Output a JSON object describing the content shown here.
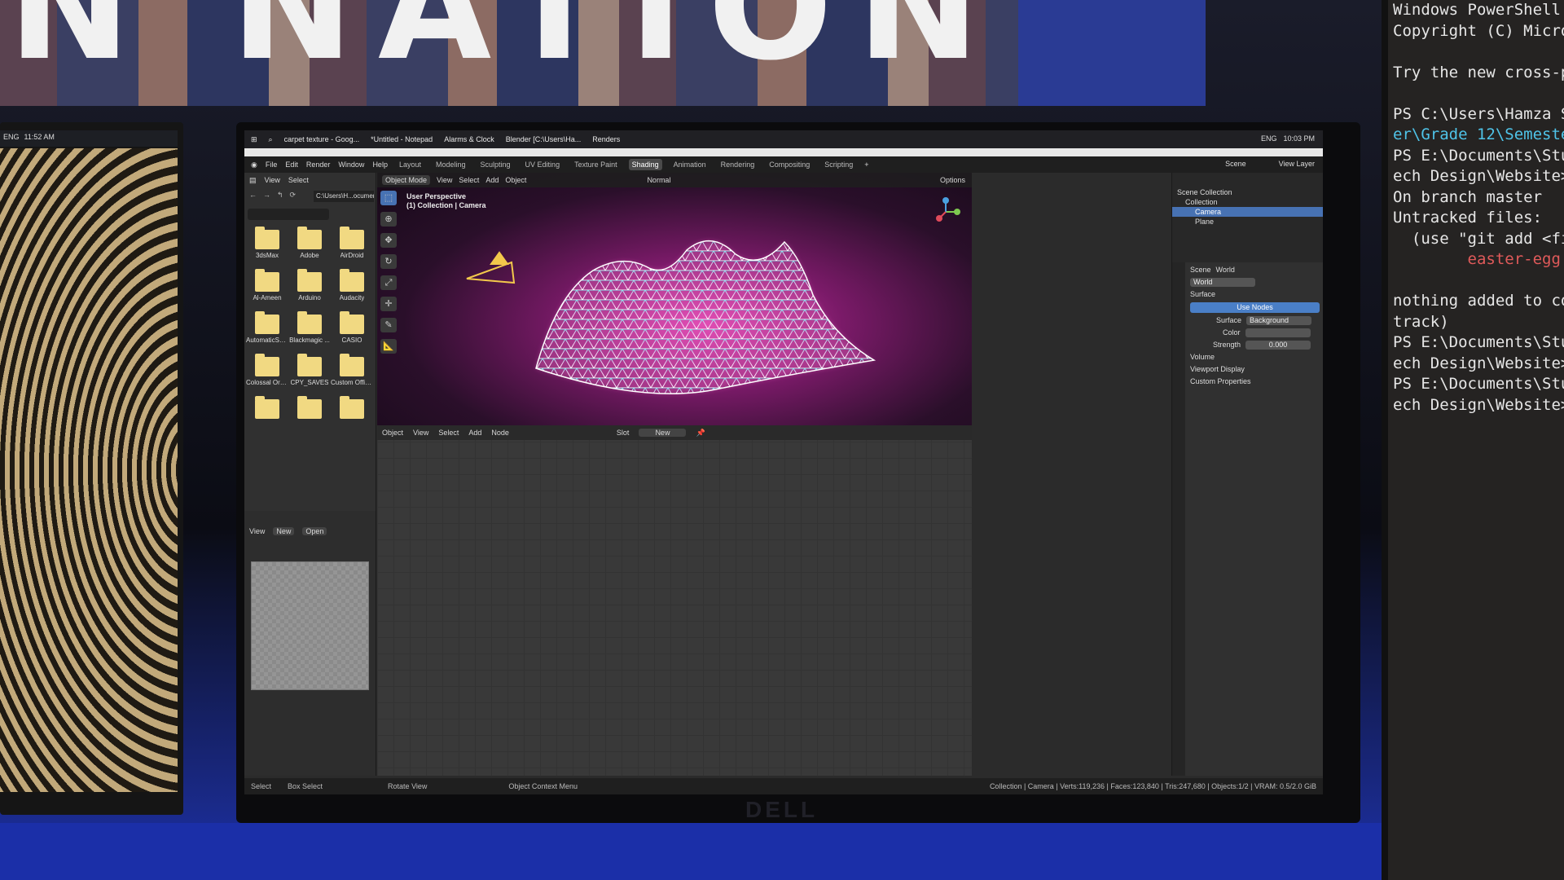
{
  "banner": {
    "text": "N NATION"
  },
  "left_monitor": {
    "status": [
      "ENG",
      "11:52 AM"
    ]
  },
  "terminal": {
    "lines": [
      "Windows PowerShell",
      "Copyright (C) Micro",
      "",
      "Try the new cross-p",
      "",
      "PS C:\\Users\\Hamza S",
      "er\\Grade 12\\Semeste",
      "PS E:\\Documents\\Stu",
      "ech Design\\Website>",
      "On branch master",
      "Untracked files:",
      "  (use \"git add <fi",
      "        easter-egg.",
      "",
      "nothing added to co",
      "track)",
      "PS E:\\Documents\\Stu",
      "ech Design\\Website>",
      "PS E:\\Documents\\Stu",
      "ech Design\\Website>"
    ]
  },
  "taskbar": {
    "items": [
      "carpet texture - Goog...",
      "*Untitled - Notepad",
      "Alarms & Clock",
      "Blender [C:\\Users\\Ha...",
      "Renders"
    ],
    "lang": "ENG",
    "time": "10:03 PM"
  },
  "menubar": {
    "menus": [
      "File",
      "Edit",
      "Render",
      "Window",
      "Help"
    ],
    "workspaces": [
      "Layout",
      "Modeling",
      "Sculpting",
      "UV Editing",
      "Texture Paint",
      "Shading",
      "Animation",
      "Rendering",
      "Compositing",
      "Scripting"
    ],
    "active_workspace": "Shading",
    "scene": "Scene",
    "view_layer": "View Layer"
  },
  "file_browser": {
    "menus": [
      "View",
      "Select"
    ],
    "path": "C:\\Users\\H...ocuments\\",
    "folders": [
      "3dsMax",
      "Adobe",
      "AirDroid",
      "Al-Ameen",
      "Arduino",
      "Audacity",
      "AutomaticSol...",
      "Blackmagic ...",
      "CASIO",
      "Colossal Order",
      "CPY_SAVES",
      "Custom Offic...",
      "",
      "",
      ""
    ]
  },
  "image_editor": {
    "view": "View",
    "new": "New",
    "open": "Open"
  },
  "viewport": {
    "mode": "Object Mode",
    "menus": [
      "View",
      "Select",
      "Add",
      "Object"
    ],
    "orientation": "Normal",
    "options": "Options",
    "info_line1": "User Perspective",
    "info_line2": "(1) Collection | Camera"
  },
  "node_editor": {
    "mode": "Object",
    "menus": [
      "View",
      "Select",
      "Add",
      "Node"
    ],
    "slot": "Slot",
    "new": "New"
  },
  "outliner": {
    "rows": [
      "Scene Collection",
      "Collection",
      "Camera",
      "Plane"
    ],
    "selected": "Camera"
  },
  "properties": {
    "scene": "Scene",
    "world_tab": "World",
    "world_name": "World",
    "surface_panel": "Surface",
    "use_nodes": "Use Nodes",
    "surface_label": "Surface",
    "surface_value": "Background",
    "color_label": "Color",
    "strength_label": "Strength",
    "strength_value": "0.000",
    "panels": [
      "Volume",
      "Viewport Display",
      "Custom Properties"
    ]
  },
  "statusbar": {
    "select": "Select",
    "box_select": "Box Select",
    "rotate_view": "Rotate View",
    "context_menu": "Object Context Menu",
    "stats": "Collection | Camera | Verts:119,236 | Faces:123,840 | Tris:247,680 | Objects:1/2 | VRAM: 0.5/2.0 GiB"
  },
  "monitor_brand": "DELL",
  "colors": {
    "accent": "#4772b3",
    "glow": "#e040b8",
    "mesh_top": "#7ee8f0",
    "camera": "#f2c84b"
  }
}
